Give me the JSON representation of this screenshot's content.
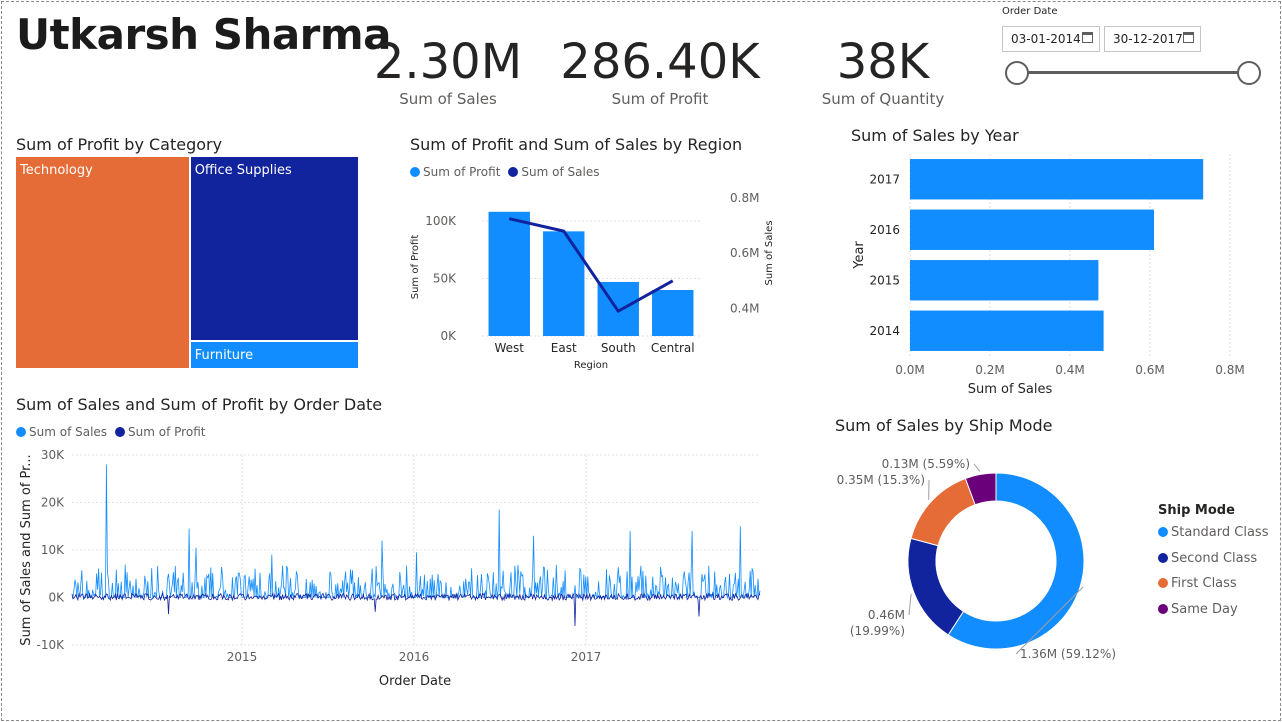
{
  "report_title": "Utkarsh Sharma",
  "kpis": [
    {
      "value": "2.30M",
      "label": "Sum of Sales"
    },
    {
      "value": "286.40K",
      "label": "Sum of Profit"
    },
    {
      "value": "38K",
      "label": "Sum of Quantity"
    }
  ],
  "slicer": {
    "title": "Order Date",
    "start": "03-01-2014",
    "end": "30-12-2017",
    "range_fraction": [
      0,
      1
    ]
  },
  "colors": {
    "light_blue": "#118DFF",
    "dark_blue": "#12239E",
    "orange": "#E66C37",
    "purple": "#6B007B"
  },
  "chart_data": [
    {
      "type": "treemap",
      "title": "Sum of Profit by Category",
      "categories": [
        "Technology",
        "Office Supplies",
        "Furniture"
      ],
      "values": [
        145.45,
        122.49,
        18.45
      ],
      "colors": [
        "#E66C37",
        "#12239E",
        "#118DFF"
      ]
    },
    {
      "type": "bar",
      "title": "Sum of Profit and Sum of Sales by Region",
      "categories": [
        "West",
        "East",
        "South",
        "Central"
      ],
      "series": [
        {
          "name": "Sum of Profit",
          "type": "bar",
          "values": [
            108000,
            91000,
            47000,
            40000
          ]
        },
        {
          "name": "Sum of Sales",
          "type": "line",
          "values": [
            725000,
            680000,
            390000,
            500000
          ]
        }
      ],
      "xlabel": "Region",
      "ylabel": "Sum of Profit",
      "y2label": "Sum of Sales",
      "y_ticks": [
        "0K",
        "50K",
        "100K"
      ],
      "y2_ticks": [
        "0.4M",
        "0.6M",
        "0.8M"
      ],
      "ylim": [
        0,
        120000
      ],
      "y2lim": [
        0.3,
        0.8
      ],
      "legend": "top-left"
    },
    {
      "type": "bar",
      "orientation": "horizontal",
      "title": "Sum of Sales by Year",
      "categories": [
        "2017",
        "2016",
        "2015",
        "2014"
      ],
      "values": [
        0.733,
        0.61,
        0.471,
        0.484
      ],
      "xlabel": "Sum of Sales",
      "ylabel": "Year",
      "x_ticks": [
        "0.0M",
        "0.2M",
        "0.4M",
        "0.6M",
        "0.8M"
      ],
      "xlim": [
        0,
        0.8
      ]
    },
    {
      "type": "line",
      "title": "Sum of Sales and Sum of Profit by Order Date",
      "series": [
        {
          "name": "Sum of Sales"
        },
        {
          "name": "Sum of Profit"
        }
      ],
      "xlabel": "Order Date",
      "ylabel": "Sum of Sales and Sum of Pr...",
      "x_ticks": [
        "2015",
        "2016",
        "2017"
      ],
      "y_ticks": [
        "-10K",
        "0K",
        "10K",
        "20K",
        "30K"
      ],
      "ylim": [
        -10000,
        30000
      ],
      "sales_peaks": [
        {
          "t": 0.05,
          "v": 28000
        },
        {
          "t": 0.17,
          "v": 14500
        },
        {
          "t": 0.18,
          "v": 10500
        },
        {
          "t": 0.29,
          "v": 9000
        },
        {
          "t": 0.45,
          "v": 12000
        },
        {
          "t": 0.5,
          "v": 9500
        },
        {
          "t": 0.62,
          "v": 18500
        },
        {
          "t": 0.67,
          "v": 13000
        },
        {
          "t": 0.81,
          "v": 14000
        },
        {
          "t": 0.9,
          "v": 14000
        },
        {
          "t": 0.97,
          "v": 15000
        }
      ],
      "profit_dips": [
        {
          "t": 0.14,
          "v": -3500
        },
        {
          "t": 0.44,
          "v": -3000
        },
        {
          "t": 0.73,
          "v": -6000
        },
        {
          "t": 0.91,
          "v": -4000
        }
      ],
      "legend": "top-left"
    },
    {
      "type": "pie",
      "donut": true,
      "title": "Sum of Sales by Ship Mode",
      "legend_title": "Ship Mode",
      "categories": [
        "Standard Class",
        "Second Class",
        "First Class",
        "Same Day"
      ],
      "values": [
        1.36,
        0.46,
        0.35,
        0.13
      ],
      "percents": [
        59.12,
        19.99,
        15.3,
        5.59
      ],
      "data_labels": [
        "1.36M (59.12%)",
        "0.46M (19.99%)",
        "0.35M (15.3%)",
        "0.13M (5.59%)"
      ],
      "colors": [
        "#118DFF",
        "#12239E",
        "#E66C37",
        "#6B007B"
      ],
      "legend": "right"
    }
  ]
}
